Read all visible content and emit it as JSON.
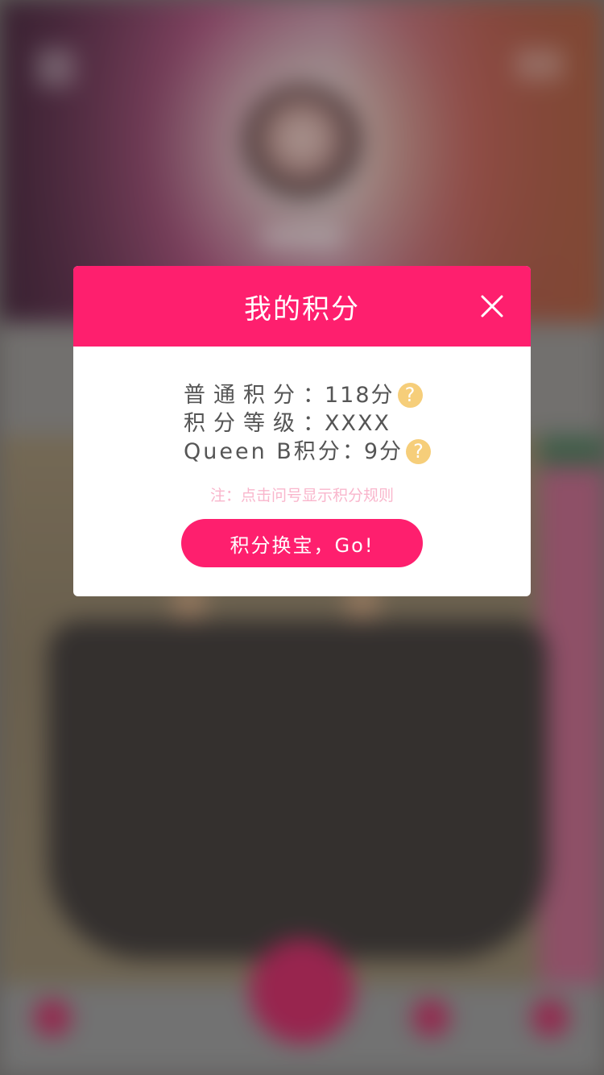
{
  "modal": {
    "title": "我的积分",
    "close_icon": "close-icon",
    "rows": [
      {
        "label": "普通积分",
        "separator": "：",
        "value": "118分",
        "has_help": true
      },
      {
        "label": "积分等级",
        "separator": "：",
        "value": "XXXX",
        "has_help": false
      },
      {
        "label": "Queen B积分",
        "separator": "：",
        "value": "9分",
        "has_help": true
      }
    ],
    "help_icon_glyph": "?",
    "note": "注：点击问号显示积分规则",
    "button_label": "积分换宝，Go!"
  },
  "colors": {
    "accent": "#fe1f6e",
    "help_icon": "#f6ce7a",
    "note_text": "#f9b6cc"
  }
}
